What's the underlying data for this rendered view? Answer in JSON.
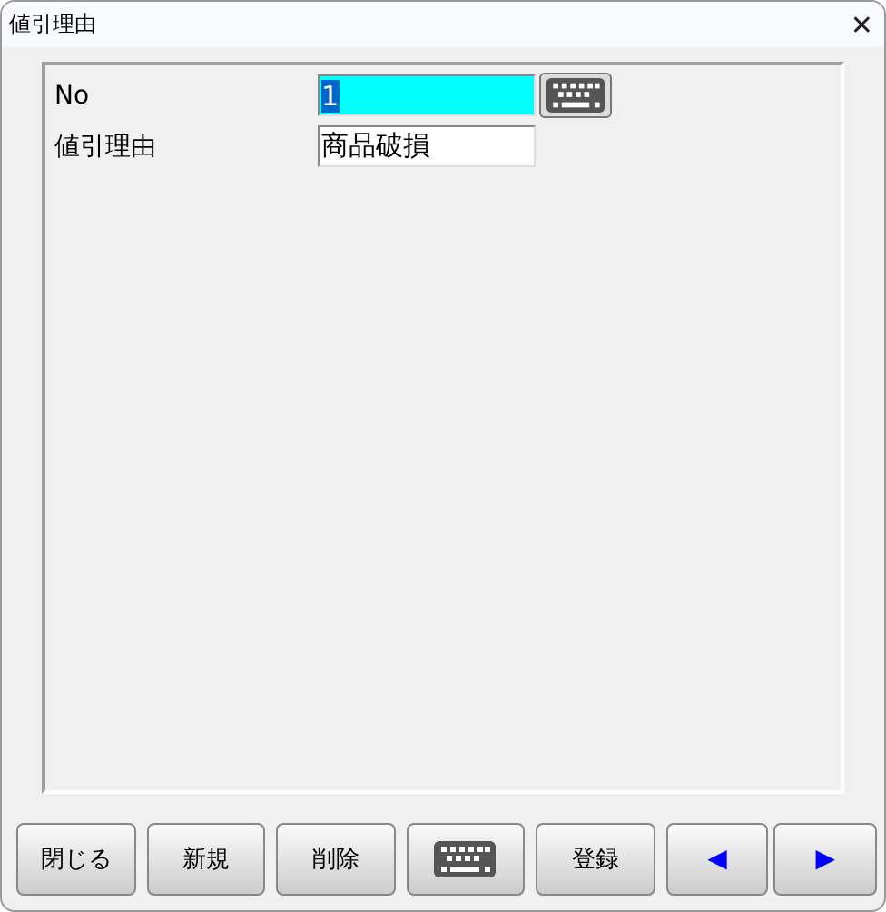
{
  "window": {
    "title": "値引理由",
    "close": "✕"
  },
  "fields": [
    {
      "label": "No",
      "value": "1",
      "highlighted": true,
      "value_selected": true,
      "keyboard_button": true
    },
    {
      "label": "値引理由",
      "value": "商品破損",
      "highlighted": false,
      "value_selected": false,
      "keyboard_button": false
    }
  ],
  "buttons": [
    {
      "kind": "text",
      "label": "閉じる"
    },
    {
      "kind": "text",
      "label": "新規"
    },
    {
      "kind": "text",
      "label": "削除"
    },
    {
      "kind": "keyboard"
    },
    {
      "kind": "text",
      "label": "登録"
    },
    {
      "kind": "arrow",
      "label": "◀"
    },
    {
      "kind": "arrow",
      "label": "▶"
    }
  ]
}
